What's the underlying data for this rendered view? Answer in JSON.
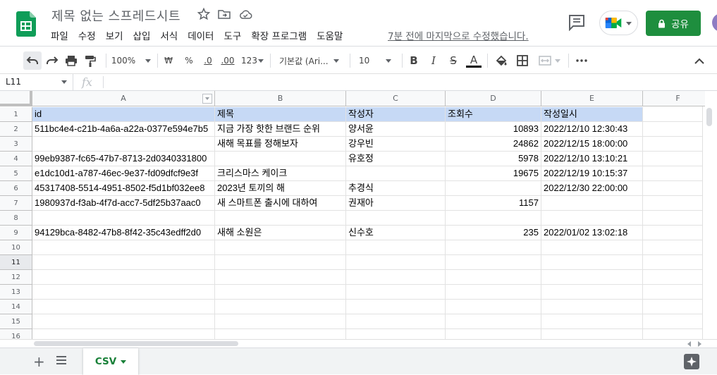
{
  "header": {
    "doc_title": "제목 없는 스프레드시트",
    "menu": [
      "파일",
      "수정",
      "보기",
      "삽입",
      "서식",
      "데이터",
      "도구",
      "확장 프로그램",
      "도움말"
    ],
    "last_edit": "7분 전에 마지막으로 수정했습니다.",
    "share_label": "공유",
    "brand_color": "#0f9d58",
    "share_color": "#1e8e3e"
  },
  "toolbar": {
    "zoom": "100%",
    "currency": "₩",
    "percent": "%",
    "decimal_decrease": ".0",
    "decimal_increase": ".00",
    "more_formats": "123",
    "font": "기본값 (Ari...",
    "font_size": "10",
    "bold": "B",
    "italic": "I",
    "strike": "S",
    "text_color": "A"
  },
  "formula_bar": {
    "name_box": "L11",
    "fx": "fx",
    "value": ""
  },
  "columns": [
    "A",
    "B",
    "C",
    "D",
    "E",
    "F"
  ],
  "rows": [
    "1",
    "2",
    "3",
    "4",
    "5",
    "6",
    "7",
    "8",
    "9",
    "10",
    "11",
    "12",
    "13",
    "14",
    "15",
    "16"
  ],
  "active_row": "11",
  "table": {
    "header": [
      "id",
      "제목",
      "작성자",
      "조회수",
      "작성일시"
    ],
    "rows": [
      [
        "511bc4e4-c21b-4a6a-a22a-0377e594e7b5",
        "지금 가장 핫한 브랜드 순위",
        "양서윤",
        "10893",
        "2022/12/10 12:30:43"
      ],
      [
        "",
        "새해 목표를 정해보자",
        "강우빈",
        "24862",
        "2022/12/15 18:00:00"
      ],
      [
        "99eb9387-fc65-47b7-8713-2d0340331800",
        "",
        "유호정",
        "5978",
        "2022/12/10 13:10:21"
      ],
      [
        "e1dc10d1-a787-46ec-9e37-fd09dfcf9e3f",
        "크리스마스 케이크",
        "",
        "19675",
        "2022/12/19 10:15:37"
      ],
      [
        "45317408-5514-4951-8502-f5d1bf032ee8",
        "2023년 토끼의 해",
        "추경식",
        "",
        "2022/12/30 22:00:00"
      ],
      [
        "1980937d-f3ab-4f7d-acc7-5df25b37aac0",
        "새 스마트폰 출시에 대하여",
        "권재아",
        "1157",
        ""
      ],
      [
        "",
        "",
        "",
        "",
        ""
      ],
      [
        "94129bca-8482-47b8-8f42-35c43edff2d0",
        "새해 소원은",
        "신수호",
        "235",
        "2022/01/02 13:02:18"
      ]
    ]
  },
  "sheet_tab": "CSV"
}
